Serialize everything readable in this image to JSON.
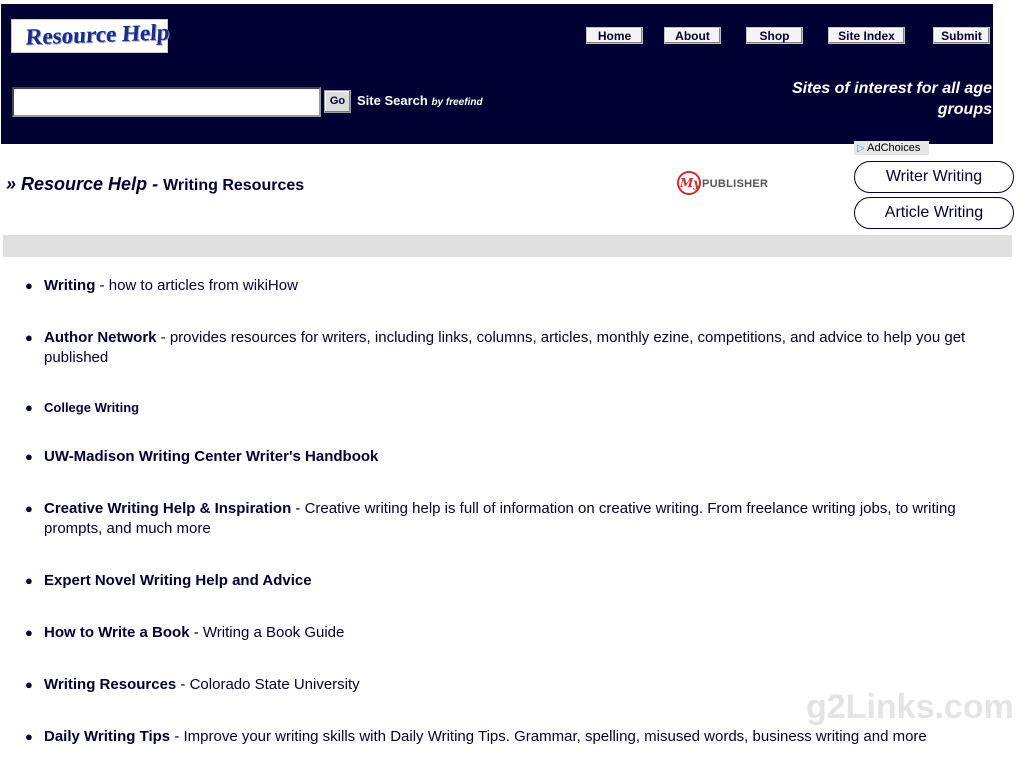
{
  "header": {
    "logo_text": "Resource Help",
    "nav": [
      "Home",
      "About",
      "Shop",
      "Site Index",
      "Submit"
    ],
    "search": {
      "button": "Go",
      "label": "Site Search",
      "by": "by freefind"
    },
    "tagline": "Sites of interest for all age groups"
  },
  "title": {
    "prefix": "» ",
    "section": "Resource Help",
    "separator": " - ",
    "page": "Writing Resources"
  },
  "ads": {
    "badge": "PUBLISHER",
    "badge_my": "My",
    "adchoices": "AdChoices",
    "buttons": [
      "Writer Writing",
      "Article Writing"
    ]
  },
  "items": [
    {
      "title": "Writing",
      "desc": " - how to articles from wikiHow"
    },
    {
      "title": "Author Network",
      "desc": " - provides resources for writers, including links, columns, articles, monthly ezine, competitions, and advice to help you get published"
    },
    {
      "title": "College Writing",
      "desc": ""
    },
    {
      "title": "UW-Madison Writing Center Writer's Handbook",
      "desc": ""
    },
    {
      "title": "Creative Writing Help & Inspiration",
      "desc": " - Creative writing help is full of information on creative writing. From freelance writing jobs, to writing prompts, and much more"
    },
    {
      "title": "Expert Novel Writing Help and Advice",
      "desc": ""
    },
    {
      "title": "How to Write a Book",
      "desc": " - Writing a Book Guide"
    },
    {
      "title": "Writing Resources",
      "desc": " - Colorado State University"
    },
    {
      "title": "Daily Writing Tips",
      "desc": " - Improve your writing skills with Daily Writing Tips. Grammar, spelling, misused words, business writing and more"
    }
  ],
  "watermark": "g2Links.com",
  "colors": {
    "header_bg": "#000033",
    "link": "#000033",
    "divider": "#e0e0e0"
  }
}
